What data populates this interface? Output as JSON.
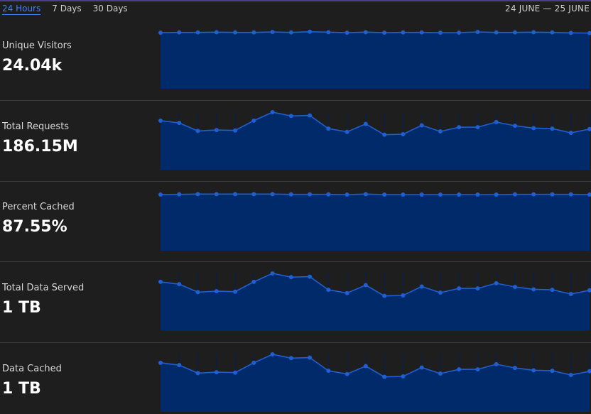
{
  "tabs": [
    {
      "label": "24 Hours",
      "active": true
    },
    {
      "label": "7 Days",
      "active": false
    },
    {
      "label": "30 Days",
      "active": false
    }
  ],
  "date_range": "24 JUNE — 25 JUNE",
  "colors": {
    "accent": "#3e7fff",
    "area_fill": "#012a6b",
    "line": "#1f5fd1",
    "spike": "#0b1f45",
    "background": "#1e1e1e"
  },
  "metrics": [
    {
      "label": "Unique Visitors",
      "value": "24.04k",
      "series": [
        0.97,
        0.975,
        0.975,
        0.98,
        0.975,
        0.975,
        0.985,
        0.975,
        0.99,
        0.98,
        0.97,
        0.98,
        0.97,
        0.975,
        0.975,
        0.97,
        0.97,
        0.985,
        0.975,
        0.975,
        0.98,
        0.975,
        0.965,
        0.96
      ],
      "spikes": false
    },
    {
      "label": "Total Requests",
      "value": "186.15M",
      "series": [
        0.82,
        0.77,
        0.6,
        0.62,
        0.61,
        0.82,
        1.0,
        0.92,
        0.93,
        0.65,
        0.58,
        0.75,
        0.52,
        0.53,
        0.72,
        0.59,
        0.68,
        0.68,
        0.79,
        0.71,
        0.66,
        0.65,
        0.56,
        0.64
      ],
      "spikes": true
    },
    {
      "label": "Percent Cached",
      "value": "87.55%",
      "series": [
        0.97,
        0.975,
        0.98,
        0.98,
        0.98,
        0.98,
        0.98,
        0.975,
        0.975,
        0.975,
        0.97,
        0.98,
        0.97,
        0.97,
        0.97,
        0.97,
        0.97,
        0.97,
        0.97,
        0.975,
        0.975,
        0.975,
        0.975,
        0.97
      ],
      "spikes": false
    },
    {
      "label": "Total Data Served",
      "value": "1 TB",
      "series": [
        0.82,
        0.77,
        0.6,
        0.62,
        0.61,
        0.82,
        1.0,
        0.92,
        0.93,
        0.65,
        0.58,
        0.75,
        0.52,
        0.53,
        0.72,
        0.59,
        0.68,
        0.68,
        0.79,
        0.71,
        0.66,
        0.65,
        0.56,
        0.64
      ],
      "spikes": true
    },
    {
      "label": "Data Cached",
      "value": "1 TB",
      "series": [
        0.82,
        0.77,
        0.6,
        0.62,
        0.61,
        0.82,
        1.0,
        0.92,
        0.93,
        0.65,
        0.58,
        0.75,
        0.52,
        0.53,
        0.72,
        0.59,
        0.68,
        0.68,
        0.79,
        0.71,
        0.66,
        0.65,
        0.56,
        0.64
      ],
      "spikes": true
    }
  ]
}
